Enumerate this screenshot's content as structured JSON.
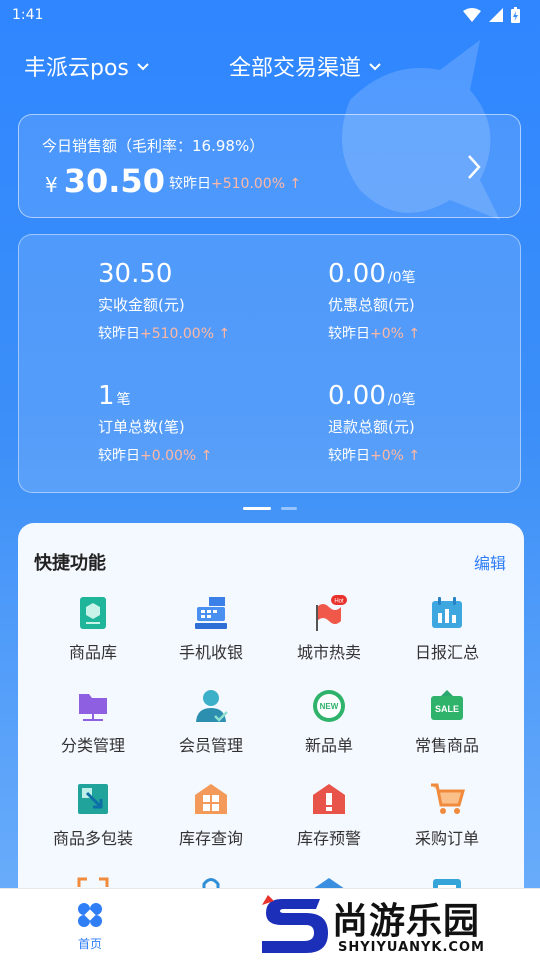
{
  "status": {
    "time": "1:41"
  },
  "header": {
    "store": "丰派云pos",
    "channel": "全部交易渠道"
  },
  "sales": {
    "title": "今日销售额（毛利率：16.98%）",
    "currency": "¥",
    "amount": "30.50",
    "compare_label": "较昨日",
    "compare_value": "+510.00%",
    "up_arrow": "↑"
  },
  "stats": [
    {
      "value": "30.50",
      "unit": "",
      "label": "实收金额(元)",
      "compare_label": "较昨日",
      "compare_value": "+510.00%",
      "arrow": "↑"
    },
    {
      "value": "0.00",
      "unit": "/0笔",
      "label": "优惠总额(元)",
      "compare_label": "较昨日",
      "compare_value": "+0%",
      "arrow": "↑"
    },
    {
      "value": "1",
      "unit": "笔",
      "label": "订单总数(笔)",
      "compare_label": "较昨日",
      "compare_value": "+0.00%",
      "arrow": "↑"
    },
    {
      "value": "0.00",
      "unit": "/0笔",
      "label": "退款总额(元)",
      "compare_label": "较昨日",
      "compare_value": "+0%",
      "arrow": "↑"
    }
  ],
  "quick": {
    "title": "快捷功能",
    "edit": "编辑",
    "items": [
      {
        "label": "商品库",
        "icon": "product-library-icon"
      },
      {
        "label": "手机收银",
        "icon": "cash-register-icon"
      },
      {
        "label": "城市热卖",
        "icon": "hot-flag-icon",
        "badge": "Hot"
      },
      {
        "label": "日报汇总",
        "icon": "daily-report-icon"
      },
      {
        "label": "分类管理",
        "icon": "category-folder-icon"
      },
      {
        "label": "会员管理",
        "icon": "member-icon"
      },
      {
        "label": "新品单",
        "icon": "new-badge-icon",
        "badge": "NEW"
      },
      {
        "label": "常售商品",
        "icon": "sale-tag-icon",
        "badge": "SALE"
      },
      {
        "label": "商品多包装",
        "icon": "multi-pack-icon"
      },
      {
        "label": "库存查询",
        "icon": "stock-query-icon"
      },
      {
        "label": "库存预警",
        "icon": "stock-alert-icon"
      },
      {
        "label": "采购订单",
        "icon": "shopping-cart-icon"
      }
    ]
  },
  "tabbar": {
    "home": "首页"
  },
  "watermark": {
    "main": "尚游乐园",
    "sub": "SHYIYUANYK.COM"
  },
  "colors": {
    "primary": "#2f86ff",
    "accent": "#2f7ef6",
    "positive": "#ffb8a4"
  }
}
